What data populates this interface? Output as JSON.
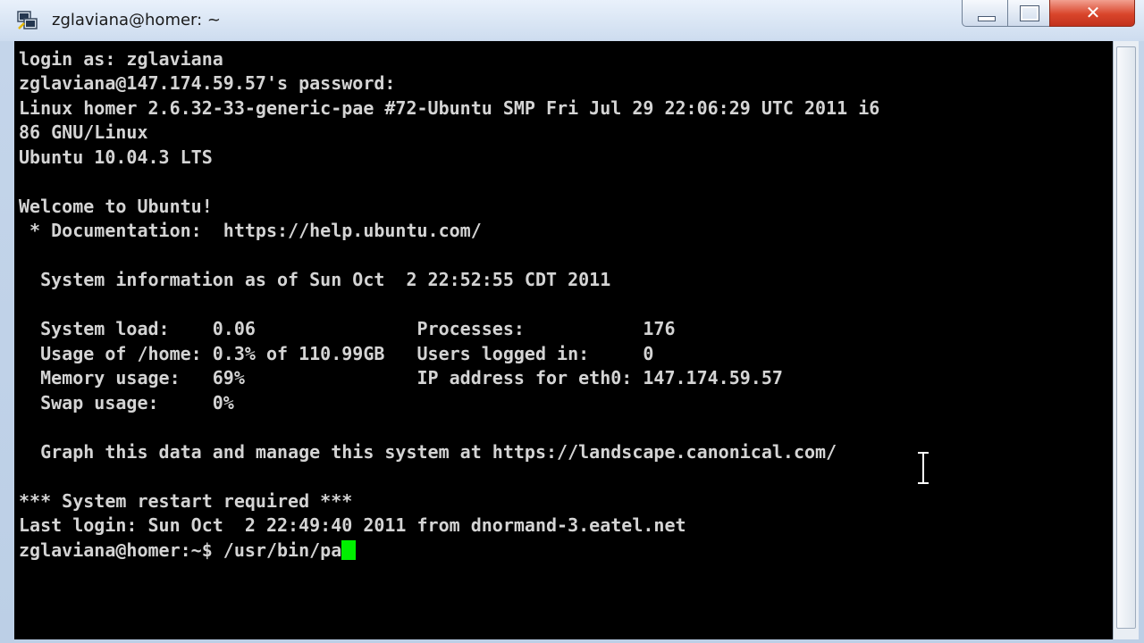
{
  "window": {
    "title": "zglaviana@homer: ~",
    "icon": "putty-icon",
    "controls": {
      "minimize": "minimize-icon",
      "maximize": "maximize-icon",
      "close_label": "✕"
    }
  },
  "terminal": {
    "lines": [
      "login as: zglaviana",
      "zglaviana@147.174.59.57's password:",
      "Linux homer 2.6.32-33-generic-pae #72-Ubuntu SMP Fri Jul 29 22:06:29 UTC 2011 i6",
      "86 GNU/Linux",
      "Ubuntu 10.04.3 LTS",
      "",
      "Welcome to Ubuntu!",
      " * Documentation:  https://help.ubuntu.com/",
      "",
      "  System information as of Sun Oct  2 22:52:55 CDT 2011",
      "",
      "  System load:    0.06               Processes:           176",
      "  Usage of /home: 0.3% of 110.99GB   Users logged in:     0",
      "  Memory usage:   69%                IP address for eth0: 147.174.59.57",
      "  Swap usage:     0%",
      "",
      "  Graph this data and manage this system at https://landscape.canonical.com/",
      "",
      "*** System restart required ***",
      "Last login: Sun Oct  2 22:49:40 2011 from dnormand-3.eatel.net"
    ],
    "prompt": "zglaviana@homer:~$ ",
    "input": "/usr/bin/pa",
    "cursor_color": "#00f000",
    "foreground_color": "#d4d4d4",
    "background_color": "#000000"
  }
}
